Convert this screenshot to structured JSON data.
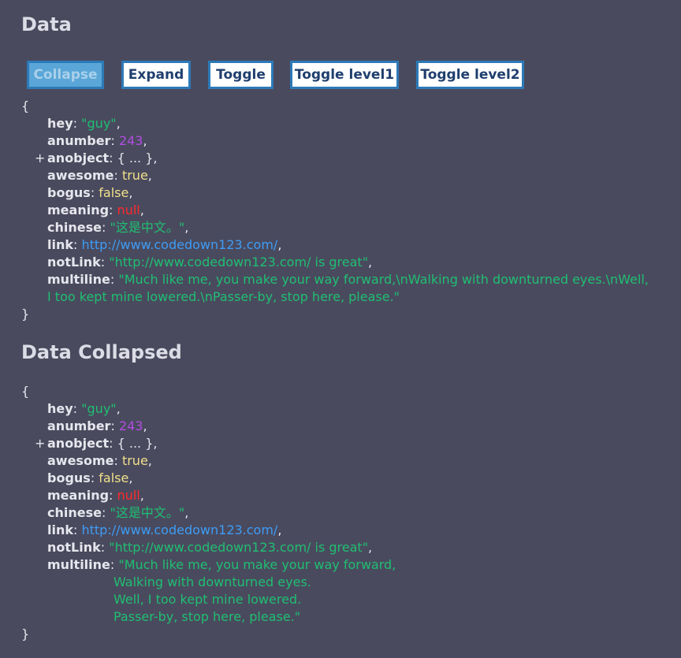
{
  "headings": {
    "data": "Data",
    "data_collapsed": "Data Collapsed"
  },
  "buttons": {
    "collapse": "Collapse",
    "expand": "Expand",
    "toggle": "Toggle",
    "toggle_level1": "Toggle level1",
    "toggle_level2": "Toggle level2"
  },
  "json": {
    "open": "{",
    "close": "}",
    "toggle_symbol": "+",
    "entries": {
      "hey": {
        "key": "hey",
        "value": "\"guy\""
      },
      "anumber": {
        "key": "anumber",
        "value": "243"
      },
      "anobject": {
        "key": "anobject",
        "value": "{ ... }"
      },
      "awesome": {
        "key": "awesome",
        "value": "true"
      },
      "bogus": {
        "key": "bogus",
        "value": "false"
      },
      "meaning": {
        "key": "meaning",
        "value": "null"
      },
      "chinese": {
        "key": "chinese",
        "value": "\"这是中文。\""
      },
      "link": {
        "key": "link",
        "value": "http://www.codedown123.com/"
      },
      "notLink": {
        "key": "notLink",
        "value": "\"http://www.codedown123.com/ is great\""
      },
      "multiline": {
        "key": "multiline",
        "value": "\"Much like me, you make your way forward,\\nWalking with downturned eyes.\\nWell, I too kept mine lowered.\\nPasser-by, stop here, please.\"",
        "lines": [
          "\"Much like me, you make your way forward,",
          "Walking with downturned eyes.",
          "Well, I too kept mine lowered.",
          "Passer-by, stop here, please.\""
        ]
      }
    }
  },
  "colors": {
    "background": "#4a4a5e",
    "string": "#1fbf72",
    "number": "#b04de0",
    "boolean": "#f0e08a",
    "null": "#ff2a2a",
    "link": "#3d9cf5",
    "button_border": "#2d7ab8"
  }
}
